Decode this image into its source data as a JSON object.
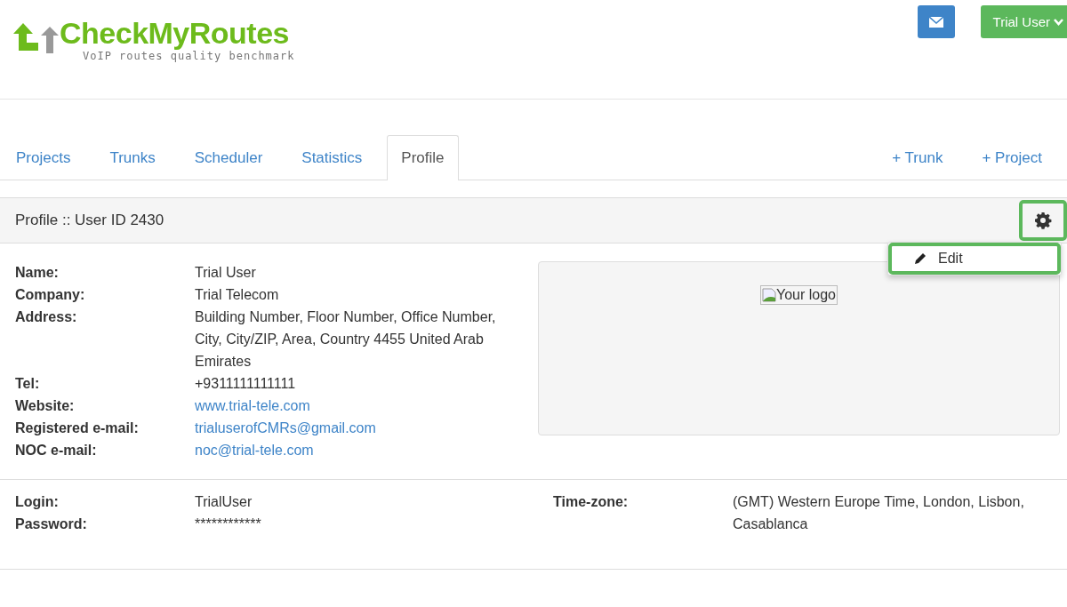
{
  "header": {
    "logo": {
      "name": "CheckMyRoutes",
      "tagline": "VoIP routes quality benchmark"
    },
    "user_button": "Trial User"
  },
  "tabs": [
    {
      "label": "Projects",
      "selected": false
    },
    {
      "label": "Trunks",
      "selected": false
    },
    {
      "label": "Scheduler",
      "selected": false
    },
    {
      "label": "Statistics",
      "selected": false
    },
    {
      "label": "Profile",
      "selected": true
    }
  ],
  "actions": [
    "+ Trunk",
    "+ Project"
  ],
  "panel": {
    "title": "Profile :: User ID 2430",
    "settings_highlighted": true,
    "menu": [
      {
        "label": "Edit",
        "highlighted": true
      }
    ],
    "details": [
      {
        "label": "Name:",
        "value": "Trial User",
        "kind": "text"
      },
      {
        "label": "Company:",
        "value": "Trial Telecom",
        "kind": "text"
      },
      {
        "label": "Address:",
        "value": "Building Number, Floor Number, Office Number, City, City/ZIP, Area, Country 4455 United Arab Emirates",
        "kind": "text"
      },
      {
        "label": "Tel:",
        "value": "+9311111111111",
        "kind": "text"
      },
      {
        "label": "Website:",
        "value": "www.trial-tele.com",
        "kind": "link"
      },
      {
        "label": "Registered e-mail:",
        "value": "trialuserofCMRs@gmail.com",
        "kind": "link"
      },
      {
        "label": "NOC e-mail:",
        "value": "noc@trial-tele.com",
        "kind": "link"
      }
    ],
    "logo_alt": "Your logo",
    "account": [
      {
        "label": "Login:",
        "value": "TrialUser"
      },
      {
        "label": "Password:",
        "value": "************"
      }
    ],
    "timezone": {
      "label": "Time-zone:",
      "value": "(GMT) Western Europe Time, London, Lisbon, Casablanca"
    }
  }
}
